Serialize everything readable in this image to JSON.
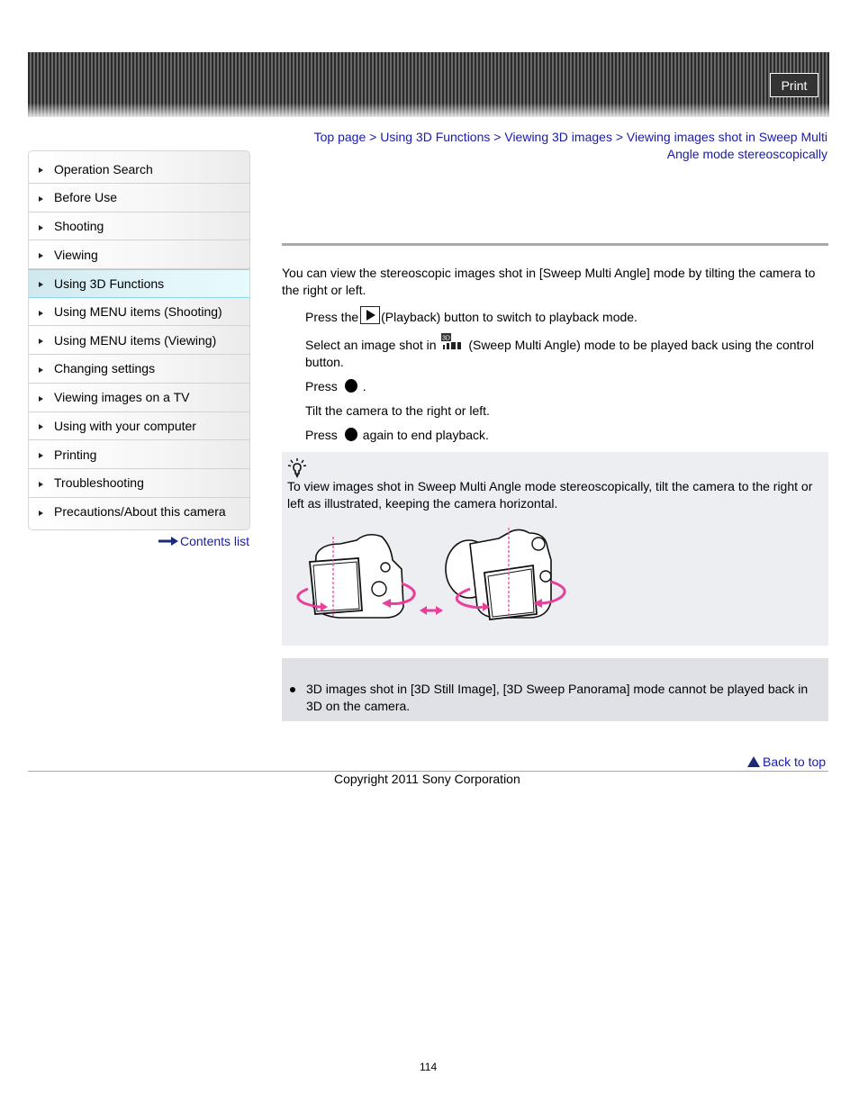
{
  "header": {
    "print_label": "Print"
  },
  "sidebar": {
    "items": [
      {
        "label": "Operation Search"
      },
      {
        "label": "Before Use"
      },
      {
        "label": "Shooting"
      },
      {
        "label": "Viewing"
      },
      {
        "label": "Using 3D Functions",
        "active": true
      },
      {
        "label": "Using MENU items (Shooting)"
      },
      {
        "label": "Using MENU items (Viewing)"
      },
      {
        "label": "Changing settings"
      },
      {
        "label": "Viewing images on a TV"
      },
      {
        "label": "Using with your computer"
      },
      {
        "label": "Printing"
      },
      {
        "label": "Troubleshooting"
      },
      {
        "label": "Precautions/About this camera"
      }
    ],
    "contents_link": "Contents list"
  },
  "breadcrumb": {
    "items": [
      "Top page",
      "Using 3D Functions",
      "Viewing 3D images",
      "Viewing images shot in Sweep Multi Angle mode stereoscopically"
    ],
    "separator": " > "
  },
  "main": {
    "intro": "You can view the stereoscopic images shot in [Sweep Multi Angle] mode by tilting the camera to the right or left.",
    "steps": [
      {
        "before": "Press the",
        "icon": "playback-icon",
        "after": "(Playback) button to switch to playback mode."
      },
      {
        "before": "Select an image shot in",
        "icon": "sweep-multi-angle-icon",
        "after": "(Sweep Multi Angle) mode to be played back using the control button."
      },
      {
        "before": "Press",
        "icon": "control-center-dot-icon",
        "after": "."
      },
      {
        "before": "Tilt the camera to the right or left.",
        "icon": null,
        "after": ""
      },
      {
        "before": "Press",
        "icon": "control-center-dot-icon",
        "after": "again to end playback."
      }
    ],
    "hint": {
      "icon": "lightbulb-icon",
      "text": "To view images shot in Sweep Multi Angle mode stereoscopically, tilt the camera to the right or left as illustrated, keeping the camera horizontal.",
      "illustration": "camera-tilt-illustration",
      "accent_color": "#e8409a"
    },
    "note": {
      "items": [
        "3D images shot in [3D Still Image], [3D Sweep Panorama] mode cannot be played back in 3D on the camera."
      ]
    }
  },
  "footer": {
    "back_to_top": "Back to top",
    "copyright": "Copyright 2011 Sony Corporation",
    "page_number": "114"
  },
  "colors": {
    "link": "#1a1aa8",
    "active_nav": "#e3f6f9",
    "hint_bg": "#eceef2",
    "note_bg": "#dfe1e6"
  }
}
